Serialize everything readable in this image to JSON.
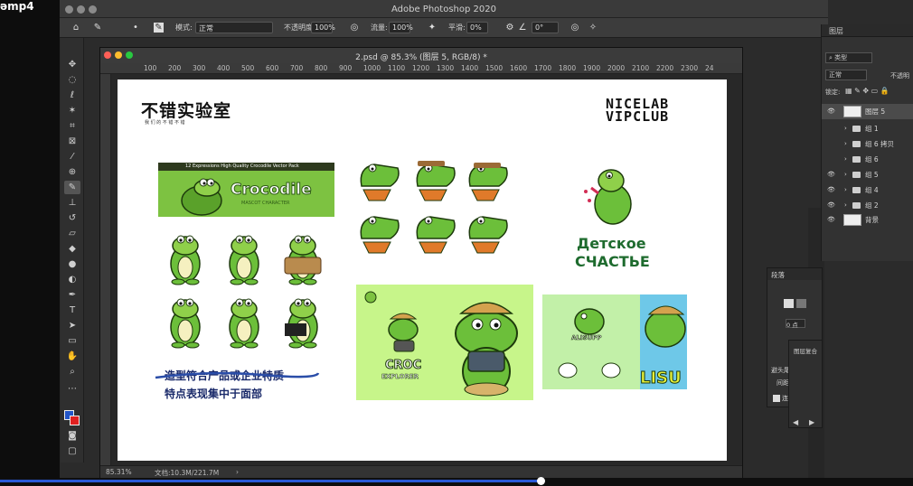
{
  "video": {
    "filename_fragment": "əmp4"
  },
  "app": {
    "title": "Adobe Photoshop 2020"
  },
  "options_bar": {
    "mode_label": "模式:",
    "mode_value": "正常",
    "opacity_label": "不透明度:",
    "opacity_value": "100%",
    "flow_label": "流量:",
    "flow_value": "100%",
    "smoothing_label": "平滑:",
    "smoothing_value": "0%",
    "angle_value": "0°"
  },
  "document": {
    "tab_title": "2.psd @ 85.3% (图层 5, RGB/8) *",
    "ruler_labels": [
      "100",
      "200",
      "300",
      "400",
      "500",
      "600",
      "700",
      "800",
      "900",
      "1000",
      "1100",
      "1200",
      "1300",
      "1400",
      "1500",
      "1600",
      "1700",
      "1800",
      "1900",
      "2000",
      "2100",
      "2200",
      "2300",
      "24"
    ],
    "zoom": "85.31%",
    "doc_size": "文档:10.3M/221.7M"
  },
  "canvas": {
    "brand_left": "不错实验室",
    "brand_left_sub": "我 们 的 不 错 不 错",
    "brand_right_line1": "NICELAB",
    "brand_right_line2": "VIPCLUB",
    "banner_small": "12 Expressions High Quality Crocodile Vector Pack",
    "banner_title": "Crocodile",
    "banner_sub": "MASCOT CHARACTER",
    "note_line1": "造型符合产品或企业特质",
    "note_line2": "特点表现集中于面部",
    "ru_line1": "Детское",
    "ru_line2": "СЧАСТЬЕ",
    "croc_explorer_1": "CROC",
    "croc_explorer_2": "EXPLORER",
    "alisupp": "ALISUPP",
    "alisupp_big": "LISU"
  },
  "layers_panel": {
    "tab": "图层",
    "filter_kind": "类型",
    "blend_mode": "正常",
    "opacity_label": "不透明",
    "lock_label": "锁定:",
    "layers": [
      {
        "name": "图层 5",
        "visible": true
      },
      {
        "name": "组 1",
        "visible": false
      },
      {
        "name": "组 6 拷贝",
        "visible": false
      },
      {
        "name": "组 6",
        "visible": false
      },
      {
        "name": "组 5",
        "visible": true
      },
      {
        "name": "组 4",
        "visible": true
      },
      {
        "name": "组 2",
        "visible": true
      },
      {
        "name": "背景",
        "visible": true
      }
    ]
  },
  "paragraph_panel": {
    "tab": "段落",
    "indent_value": "0 点",
    "line1": "避头尾",
    "line2": "间距",
    "check_label": "连",
    "mini_title": "图层复合"
  },
  "colors": {
    "accent_green": "#7dc241",
    "foreground": "#2255c8",
    "background": "#e02020"
  }
}
